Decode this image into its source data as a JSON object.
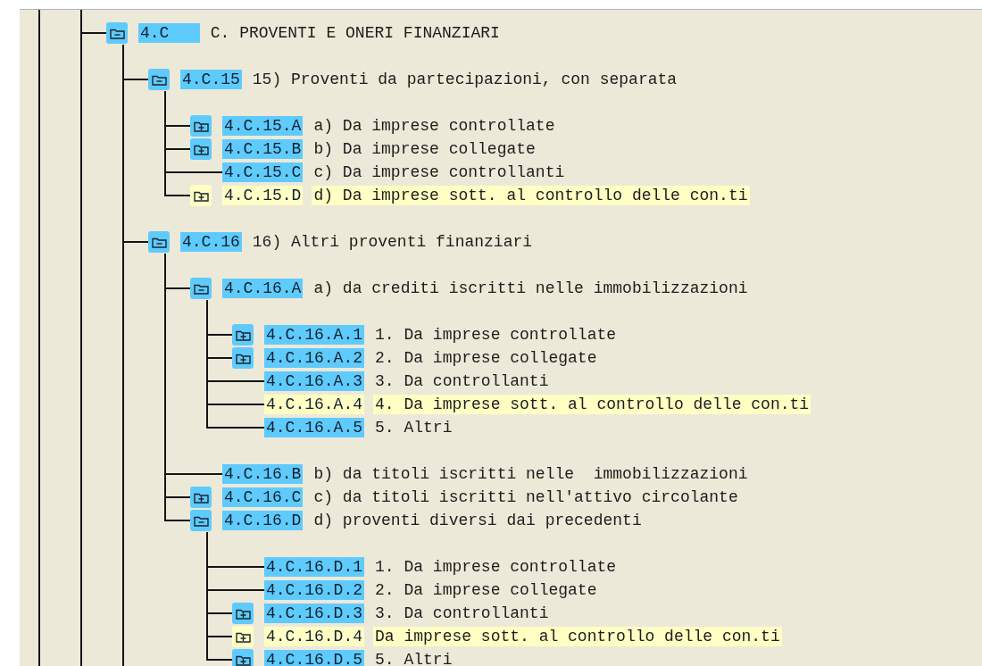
{
  "tree": {
    "nodes": [
      {
        "key": "4.C",
        "text": "C. PROVENTI E ONERI FINANZIARI",
        "kind": "folder",
        "expanded": true,
        "flagged": false,
        "continues": true,
        "children": [
          {
            "key": "4.C.15",
            "text": "15) Proventi da partecipazioni, con separata",
            "kind": "folder",
            "expanded": true,
            "flagged": false,
            "children": [
              {
                "key": "4.C.15.A",
                "text": "a) Da imprese controllate",
                "kind": "folder",
                "expanded": false,
                "flagged": false
              },
              {
                "key": "4.C.15.B",
                "text": "b) Da imprese collegate",
                "kind": "folder",
                "expanded": false,
                "flagged": false
              },
              {
                "key": "4.C.15.C",
                "text": "c) Da imprese controllanti",
                "kind": "leaf",
                "flagged": false
              },
              {
                "key": "4.C.15.D",
                "text": "d) Da imprese sott. al controllo delle con.ti",
                "kind": "folder",
                "expanded": false,
                "flagged": true
              }
            ]
          },
          {
            "key": "4.C.16",
            "text": "16) Altri proventi finanziari",
            "kind": "folder",
            "expanded": true,
            "flagged": false,
            "continues": true,
            "children": [
              {
                "key": "4.C.16.A",
                "text": "a) da crediti iscritti nelle immobilizzazioni",
                "kind": "folder",
                "expanded": true,
                "flagged": false,
                "children": [
                  {
                    "key": "4.C.16.A.1",
                    "text": "1. Da imprese controllate",
                    "kind": "folder",
                    "expanded": false,
                    "flagged": false
                  },
                  {
                    "key": "4.C.16.A.2",
                    "text": "2. Da imprese collegate",
                    "kind": "folder",
                    "expanded": false,
                    "flagged": false
                  },
                  {
                    "key": "4.C.16.A.3",
                    "text": "3. Da controllanti",
                    "kind": "leaf",
                    "flagged": false
                  },
                  {
                    "key": "4.C.16.A.4",
                    "text": "4. Da imprese sott. al controllo delle con.ti",
                    "kind": "leaf",
                    "flagged": true
                  },
                  {
                    "key": "4.C.16.A.5",
                    "text": "5. Altri",
                    "kind": "leaf",
                    "flagged": false
                  }
                ]
              },
              {
                "key": "4.C.16.B",
                "text": "b) da titoli iscritti nelle  immobilizzazioni",
                "kind": "leaf",
                "flagged": false
              },
              {
                "key": "4.C.16.C",
                "text": "c) da titoli iscritti nell'attivo circolante",
                "kind": "folder",
                "expanded": false,
                "flagged": false
              },
              {
                "key": "4.C.16.D",
                "text": "d) proventi diversi dai precedenti",
                "kind": "folder",
                "expanded": true,
                "flagged": false,
                "children": [
                  {
                    "key": "4.C.16.D.1",
                    "text": "1. Da imprese controllate",
                    "kind": "leaf",
                    "flagged": false
                  },
                  {
                    "key": "4.C.16.D.2",
                    "text": "2. Da imprese collegate",
                    "kind": "leaf",
                    "flagged": false
                  },
                  {
                    "key": "4.C.16.D.3",
                    "text": "3. Da controllanti",
                    "kind": "folder",
                    "expanded": false,
                    "flagged": false
                  },
                  {
                    "key": "4.C.16.D.4",
                    "text": "Da imprese sott. al controllo delle con.ti",
                    "kind": "folder",
                    "expanded": false,
                    "flagged": true
                  },
                  {
                    "key": "4.C.16.D.5",
                    "text": "5. Altri",
                    "kind": "folder",
                    "expanded": false,
                    "flagged": false
                  }
                ]
              }
            ]
          }
        ]
      }
    ]
  }
}
